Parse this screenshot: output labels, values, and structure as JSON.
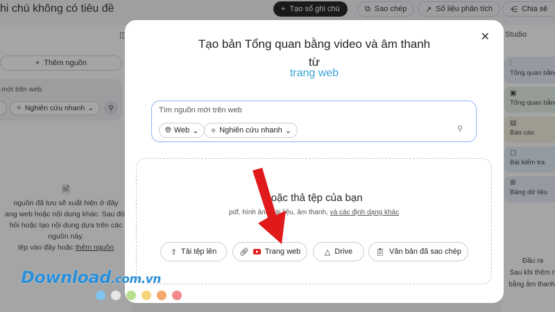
{
  "topbar": {
    "title": "hi chú không có tiêu đề",
    "create_note": "Tạo sổ ghi chú",
    "copy": "Sao chép",
    "analytics": "Số liệu phân tích",
    "share": "Chia sẻ"
  },
  "sources": {
    "add_source": "Thêm nguồn",
    "web_placeholder": "mới trên web",
    "research_chip": "Nghiên cứu nhanh",
    "empty_lines": [
      "nguồn đã lưu sẽ xuất hiện ở đây",
      "ang web hoặc nội dung khác. Sau đó,",
      "hỏi hoặc tạo nội dung dựa trên các",
      "nguồn này.",
      "tệp vào đây hoặc"
    ],
    "empty_link": "thêm nguồn"
  },
  "studio": {
    "title": "Studio",
    "cards": [
      {
        "label": "Tổng quan bằng",
        "color": "#e6eaf6",
        "icon": "audio-icon"
      },
      {
        "label": "Tổng quan bằng",
        "color": "#e3f0e3",
        "icon": "video-icon"
      },
      {
        "label": "Báo cáo",
        "color": "#f3efdc",
        "icon": "report-icon"
      },
      {
        "label": "Bài kiểm tra",
        "color": "#e1eef6",
        "icon": "quiz-icon"
      },
      {
        "label": "Bảng dữ liệu",
        "color": "#e6eaf4",
        "icon": "table-icon"
      }
    ],
    "note_lines": [
      "Đầu ra",
      "Sau khi thêm n",
      "bằng âm thanh,"
    ]
  },
  "modal": {
    "title": "Tạo bản Tổng quan bằng video và âm thanh từ",
    "subtitle": "trang web",
    "search_placeholder": "Tìm nguồn mới trên web",
    "web_select": "Web",
    "research_select": "Nghiên cứu nhanh",
    "drop_title": "hoặc thả tệp của bạn",
    "drop_types": "pdf, hình ảnh, tài liệu, âm thanh,",
    "drop_types_link": "và các định dạng khác",
    "buttons": {
      "upload": "Tải tệp lên",
      "website": "Trang web",
      "drive": "Drive",
      "copied_text": "Văn bản đã sao chép"
    }
  },
  "watermark": {
    "brand": "Download",
    "suffix": ".com.vn",
    "dot_colors": [
      "#7fc3ee",
      "#e6e6e6",
      "#b9e08e",
      "#f7d57a",
      "#f4a86b",
      "#f28a8a"
    ]
  },
  "colors": {
    "arrow": "#e0191b",
    "accent_gradient_start": "#2fb6c3",
    "accent_gradient_end": "#3e8bea"
  }
}
